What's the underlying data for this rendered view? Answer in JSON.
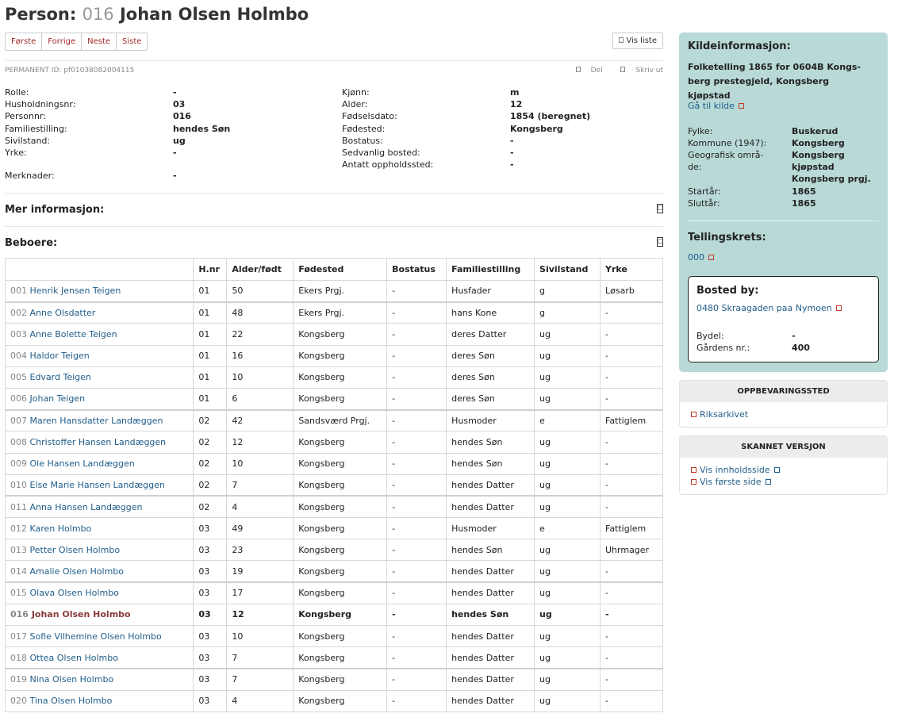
{
  "title": {
    "prefix": "Person:",
    "num": "016",
    "name": "Johan Olsen Holmbo"
  },
  "pager": {
    "first": "Første",
    "prev": "Forrige",
    "next": "Neste",
    "last": "Siste"
  },
  "vis_liste": "Vis liste",
  "permanent_id": "PERMANENT ID: pf01038082004115",
  "share": {
    "del": "Del",
    "print": "Skriv ut"
  },
  "info_left": [
    {
      "label": "Rolle:",
      "value": "-"
    },
    {
      "label": "Husholdningsnr:",
      "value": "03"
    },
    {
      "label": "Personnr:",
      "value": "016"
    },
    {
      "label": "Familiestilling:",
      "value": "hendes Søn"
    },
    {
      "label": "Sivilstand:",
      "value": "ug"
    },
    {
      "label": "Yrke:",
      "value": "-"
    }
  ],
  "merknader": {
    "label": "Merknader:",
    "value": "-"
  },
  "info_right": [
    {
      "label": "Kjønn:",
      "value": "m"
    },
    {
      "label": "Alder:",
      "value": "12"
    },
    {
      "label": "Fødselsdato:",
      "value": "1854 (beregnet)"
    },
    {
      "label": "Fødested:",
      "value": "Kongsberg"
    },
    {
      "label": "Bostatus:",
      "value": "-"
    },
    {
      "label": "Sedvanlig bosted:",
      "value": "-"
    },
    {
      "label": "Antatt oppholdssted:",
      "value": "-"
    }
  ],
  "mer_info": "Mer informasjon:",
  "beboere": "Beboere:",
  "toggle_glyph": "□",
  "columns": [
    "",
    "H.nr",
    "Alder/født",
    "Fødested",
    "Bostatus",
    "Familiestilling",
    "Sivilstand",
    "Yrke"
  ],
  "residents": [
    {
      "pn": "001",
      "name": "Henrik Jensen Teigen",
      "hnr": "01",
      "age": "50",
      "place": "Ekers Prgj.",
      "bostatus": "-",
      "fam": "Husfader",
      "siv": "g",
      "yrke": "Løsarb"
    },
    {
      "pn": "002",
      "name": "Anne Olsdatter",
      "hnr": "01",
      "age": "48",
      "place": "Ekers Prgj.",
      "bostatus": "-",
      "fam": "hans Kone",
      "siv": "g",
      "yrke": "-"
    },
    {
      "pn": "003",
      "name": "Anne Bolette Teigen",
      "hnr": "01",
      "age": "22",
      "place": "Kongsberg",
      "bostatus": "-",
      "fam": "deres Datter",
      "siv": "ug",
      "yrke": "-"
    },
    {
      "pn": "004",
      "name": "Haldor Teigen",
      "hnr": "01",
      "age": "16",
      "place": "Kongsberg",
      "bostatus": "-",
      "fam": "deres Søn",
      "siv": "ug",
      "yrke": "-"
    },
    {
      "pn": "005",
      "name": "Edvard Teigen",
      "hnr": "01",
      "age": "10",
      "place": "Kongsberg",
      "bostatus": "-",
      "fam": "deres Søn",
      "siv": "ug",
      "yrke": "-"
    },
    {
      "pn": "006",
      "name": "Johan Teigen",
      "hnr": "01",
      "age": "6",
      "place": "Kongsberg",
      "bostatus": "-",
      "fam": "deres Søn",
      "siv": "ug",
      "yrke": "-"
    },
    {
      "pn": "007",
      "name": "Maren Hansdatter Landæggen",
      "hnr": "02",
      "age": "42",
      "place": "Sandsværd Prgj.",
      "bostatus": "-",
      "fam": "Husmoder",
      "siv": "e",
      "yrke": "Fattiglem"
    },
    {
      "pn": "008",
      "name": "Christoffer Hansen Landæggen",
      "hnr": "02",
      "age": "12",
      "place": "Kongsberg",
      "bostatus": "-",
      "fam": "hendes Søn",
      "siv": "ug",
      "yrke": "-"
    },
    {
      "pn": "009",
      "name": "Ole Hansen Landæggen",
      "hnr": "02",
      "age": "10",
      "place": "Kongsberg",
      "bostatus": "-",
      "fam": "hendes Søn",
      "siv": "ug",
      "yrke": "-"
    },
    {
      "pn": "010",
      "name": "Else Marie Hansen Landæggen",
      "hnr": "02",
      "age": "7",
      "place": "Kongsberg",
      "bostatus": "-",
      "fam": "hendes Datter",
      "siv": "ug",
      "yrke": "-"
    },
    {
      "pn": "011",
      "name": "Anna Hansen Landæggen",
      "hnr": "02",
      "age": "4",
      "place": "Kongsberg",
      "bostatus": "-",
      "fam": "hendes Datter",
      "siv": "ug",
      "yrke": "-"
    },
    {
      "pn": "012",
      "name": "Karen Holmbo",
      "hnr": "03",
      "age": "49",
      "place": "Kongsberg",
      "bostatus": "-",
      "fam": "Husmoder",
      "siv": "e",
      "yrke": "Fattiglem"
    },
    {
      "pn": "013",
      "name": "Petter Olsen Holmbo",
      "hnr": "03",
      "age": "23",
      "place": "Kongsberg",
      "bostatus": "-",
      "fam": "hendes Søn",
      "siv": "ug",
      "yrke": "Uhrmager"
    },
    {
      "pn": "014",
      "name": "Amalie Olsen Holmbo",
      "hnr": "03",
      "age": "19",
      "place": "Kongsberg",
      "bostatus": "-",
      "fam": "hendes Datter",
      "siv": "ug",
      "yrke": "-"
    },
    {
      "pn": "015",
      "name": "Olava Olsen Holmbo",
      "hnr": "03",
      "age": "17",
      "place": "Kongsberg",
      "bostatus": "-",
      "fam": "hendes Datter",
      "siv": "ug",
      "yrke": "-"
    },
    {
      "pn": "016",
      "name": "Johan Olsen Holmbo",
      "hnr": "03",
      "age": "12",
      "place": "Kongsberg",
      "bostatus": "-",
      "fam": "hendes Søn",
      "siv": "ug",
      "yrke": "-"
    },
    {
      "pn": "017",
      "name": "Sofie Vilhemine Olsen Holmbo",
      "hnr": "03",
      "age": "10",
      "place": "Kongsberg",
      "bostatus": "-",
      "fam": "hendes Datter",
      "siv": "ug",
      "yrke": "-"
    },
    {
      "pn": "018",
      "name": "Ottea Olsen Holmbo",
      "hnr": "03",
      "age": "7",
      "place": "Kongsberg",
      "bostatus": "-",
      "fam": "hendes Datter",
      "siv": "ug",
      "yrke": "-"
    },
    {
      "pn": "019",
      "name": "Nina Olsen Holmbo",
      "hnr": "03",
      "age": "7",
      "place": "Kongsberg",
      "bostatus": "-",
      "fam": "hendes Datter",
      "siv": "ug",
      "yrke": "-"
    },
    {
      "pn": "020",
      "name": "Tina Olsen Holmbo",
      "hnr": "03",
      "age": "4",
      "place": "Kongsberg",
      "bostatus": "-",
      "fam": "hendes Datter",
      "siv": "ug",
      "yrke": "-"
    }
  ],
  "kilde": {
    "title": "Kildeinformasjon:",
    "source": "Folketelling 1865 for 0604B Kongs­berg prestegjeld, Kongsberg kjøpstad",
    "link": "Gå til kilde",
    "fylke_label": "Fylke:",
    "fylke": "Buskerud",
    "kommune_label": "Kommune (1947):",
    "kommune": "Kongsberg",
    "geo_label": "Geografisk områ­de:",
    "geo1": "Kongsberg",
    "geo2": "kjøpstad",
    "geo3": "Kongsberg prgj.",
    "start_label": "Startår:",
    "start": "1865",
    "slutt_label": "Sluttår:",
    "slutt": "1865",
    "krets_title": "Tellingskrets:",
    "krets": "000"
  },
  "bosted": {
    "title": "Bosted by:",
    "link": "0480 Skraagaden paa Nymoen",
    "bydel_label": "Bydel:",
    "bydel": "-",
    "gard_label": "Gårdens nr.:",
    "gard": "400"
  },
  "oppbevaring": {
    "title": "OPPBEVARINGSSTED",
    "link": "Riksarkivet"
  },
  "skannet": {
    "title": "SKANNET VERSJON",
    "link1": "Vis innholdsside",
    "link2": "Vis første side"
  }
}
